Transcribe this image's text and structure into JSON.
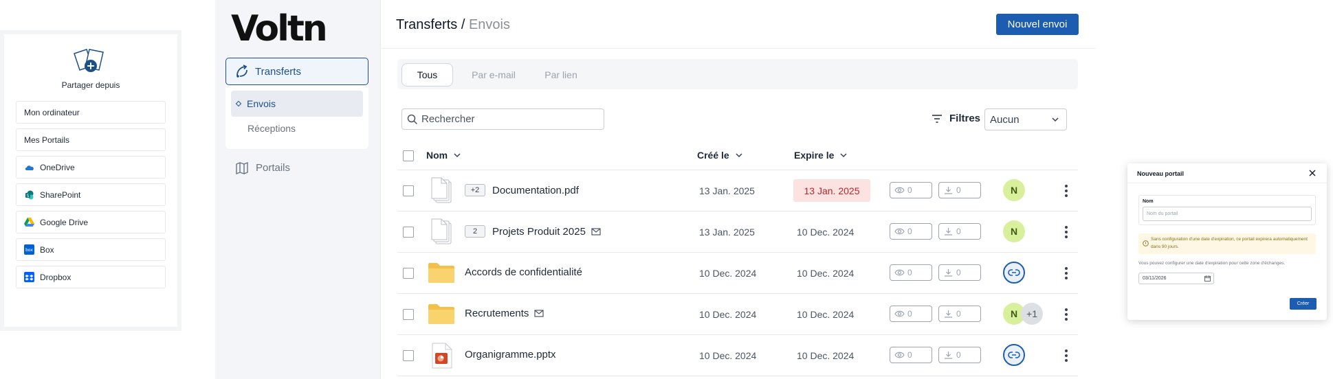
{
  "share": {
    "title": "Partager depuis",
    "items": [
      {
        "label": "Mon ordinateur",
        "icon": ""
      },
      {
        "label": "Mes Portails",
        "icon": ""
      },
      {
        "label": "OneDrive",
        "icon": "onedrive-icon"
      },
      {
        "label": "SharePoint",
        "icon": "sharepoint-icon"
      },
      {
        "label": "Google Drive",
        "icon": "google-drive-icon"
      },
      {
        "label": "Box",
        "icon": "box-icon"
      },
      {
        "label": "Dropbox",
        "icon": "dropbox-icon"
      }
    ]
  },
  "sidebar": {
    "logo": "Voltn",
    "transfers": "Transferts",
    "envois": "Envois",
    "receptions": "Réceptions",
    "portails": "Portails"
  },
  "header": {
    "title": "Transferts",
    "separator": " / ",
    "subtitle": "Envois",
    "new_button": "Nouvel envoi"
  },
  "tabs": [
    "Tous",
    "Par e-mail",
    "Par lien"
  ],
  "search": {
    "placeholder": "Rechercher"
  },
  "filters": {
    "label": "Filtres",
    "value": "Aucun"
  },
  "table": {
    "columns": {
      "name": "Nom",
      "created": "Créé le",
      "expires": "Expire le"
    },
    "rows": [
      {
        "badge": "+2",
        "name": "Documentation.pdf",
        "created": "13 Jan. 2025",
        "expires": "13 Jan. 2025",
        "expired": true,
        "views": "0",
        "downloads": "0",
        "type": "docs-stack",
        "recipient": "N",
        "extra": "",
        "mail": false
      },
      {
        "badge": "2",
        "name": "Projets Produit 2025",
        "created": "13 Jan. 2025",
        "expires": "10 Dec. 2024",
        "expired": false,
        "views": "0",
        "downloads": "0",
        "type": "docs-stack",
        "recipient": "N",
        "extra": "",
        "mail": true
      },
      {
        "badge": "",
        "name": "Accords de confidentialité",
        "created": "10 Dec. 2024",
        "expires": "10 Dec. 2024",
        "expired": false,
        "views": "0",
        "downloads": "0",
        "type": "folder",
        "recipient": "link",
        "extra": "",
        "mail": false
      },
      {
        "badge": "",
        "name": "Recrutements",
        "created": "10 Dec. 2024",
        "expires": "10 Dec. 2024",
        "expired": false,
        "views": "0",
        "downloads": "0",
        "type": "folder",
        "recipient": "N",
        "extra": "+1",
        "mail": true
      },
      {
        "badge": "",
        "name": "Organigramme.pptx",
        "created": "10 Dec. 2024",
        "expires": "10 Dec. 2024",
        "expired": false,
        "views": "0",
        "downloads": "0",
        "type": "pptx",
        "recipient": "link",
        "extra": "",
        "mail": false
      }
    ]
  },
  "modal": {
    "title": "Nouveau portail",
    "name_label": "Nom",
    "name_placeholder": "Nom du portail",
    "warning": "Sans configuration d'une date d'expiration, ce portail expirera automatiquement dans 90 jours.",
    "hint": "Vous pouvez configurer une date d'expiration pour cette zone d'échanges.",
    "date_value": "03/11/2026",
    "create_button": "Créer"
  },
  "colors": {
    "primary": "#1c5db1",
    "accent_nav": "#1c4f8c",
    "expired_bg": "#fde2e2",
    "avatar_bg": "#d8ef9c",
    "folder": "#f7c948"
  }
}
